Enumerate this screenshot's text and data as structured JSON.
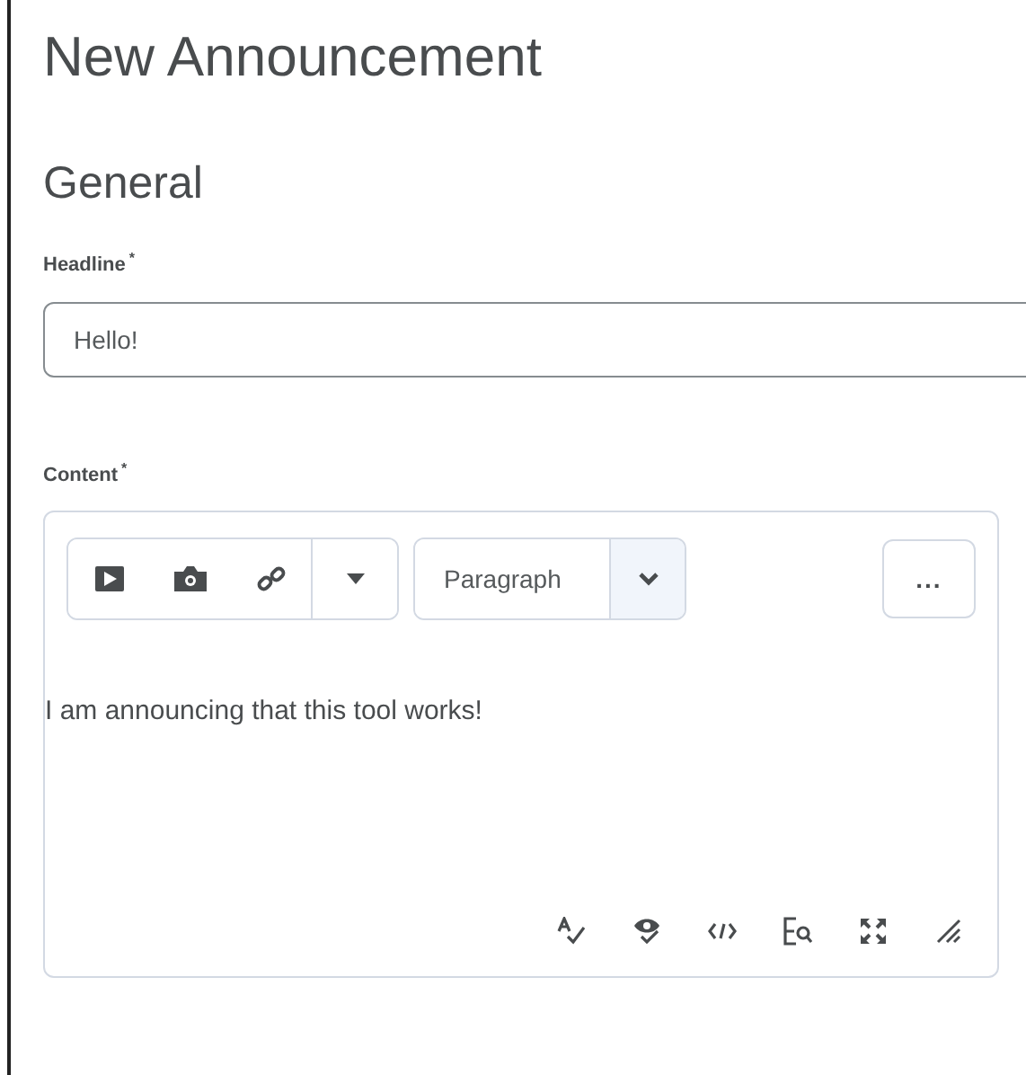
{
  "title": "New Announcement",
  "section": "General",
  "headline": {
    "label": "Headline",
    "required_mark": "*",
    "value": "Hello!"
  },
  "content": {
    "label": "Content",
    "required_mark": "*",
    "toolbar": {
      "insert_buttons": [
        {
          "kind": "video"
        },
        {
          "kind": "camera"
        },
        {
          "kind": "link"
        },
        {
          "kind": "dropdown"
        }
      ],
      "format": "Paragraph",
      "more": "..."
    },
    "body": "I am announcing that this tool works!",
    "bottom_tools": [
      {
        "kind": "spellcheck"
      },
      {
        "kind": "preview"
      },
      {
        "kind": "source"
      },
      {
        "kind": "find"
      },
      {
        "kind": "fullscreen"
      },
      {
        "kind": "resize"
      }
    ]
  }
}
